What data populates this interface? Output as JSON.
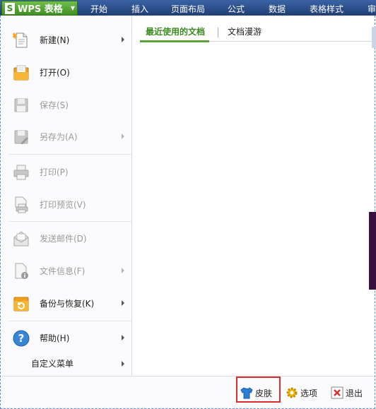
{
  "topbar": {
    "app_logo": "S",
    "app_name": "WPS 表格",
    "tabs": [
      {
        "label": "开始"
      },
      {
        "label": "插入"
      },
      {
        "label": "页面布局"
      },
      {
        "label": "公式"
      },
      {
        "label": "数据"
      },
      {
        "label": "表格样式"
      },
      {
        "label": "审阅"
      }
    ]
  },
  "menu": {
    "items": [
      {
        "label": "新建(N)",
        "icon": "new-document-icon",
        "enabled": true,
        "submenu": true
      },
      {
        "label": "打开(O)",
        "icon": "open-folder-icon",
        "enabled": true,
        "submenu": false
      },
      {
        "label": "保存(S)",
        "icon": "save-icon",
        "enabled": false,
        "submenu": false
      },
      {
        "label": "另存为(A)",
        "icon": "save-as-icon",
        "enabled": false,
        "submenu": true
      },
      {
        "label": "打印(P)",
        "icon": "printer-icon",
        "enabled": false,
        "submenu": false
      },
      {
        "label": "打印预览(V)",
        "icon": "print-preview-icon",
        "enabled": false,
        "submenu": false
      },
      {
        "label": "发送邮件(D)",
        "icon": "mail-icon",
        "enabled": false,
        "submenu": false
      },
      {
        "label": "文件信息(F)",
        "icon": "file-info-icon",
        "enabled": false,
        "submenu": true
      },
      {
        "label": "备份与恢复(K)",
        "icon": "backup-restore-icon",
        "enabled": true,
        "submenu": true
      },
      {
        "label": "帮助(H)",
        "icon": "help-icon",
        "enabled": true,
        "submenu": true
      }
    ],
    "custom_menu": {
      "label": "自定义菜单"
    }
  },
  "content": {
    "tabs": [
      {
        "label": "最近使用的文档",
        "active": true
      },
      {
        "label": "文档漫游",
        "active": false
      }
    ]
  },
  "bottombar": {
    "skin": {
      "label": "皮肤",
      "icon": "tshirt-icon"
    },
    "options": {
      "label": "选项",
      "icon": "gear-icon"
    },
    "exit": {
      "label": "退出",
      "icon": "exit-icon"
    }
  },
  "colors": {
    "accent_green": "#5aa33a",
    "ribbon_blue": "#2b4f8a",
    "highlight_red": "#d8302f",
    "disabled_text": "#9a9a9a"
  }
}
